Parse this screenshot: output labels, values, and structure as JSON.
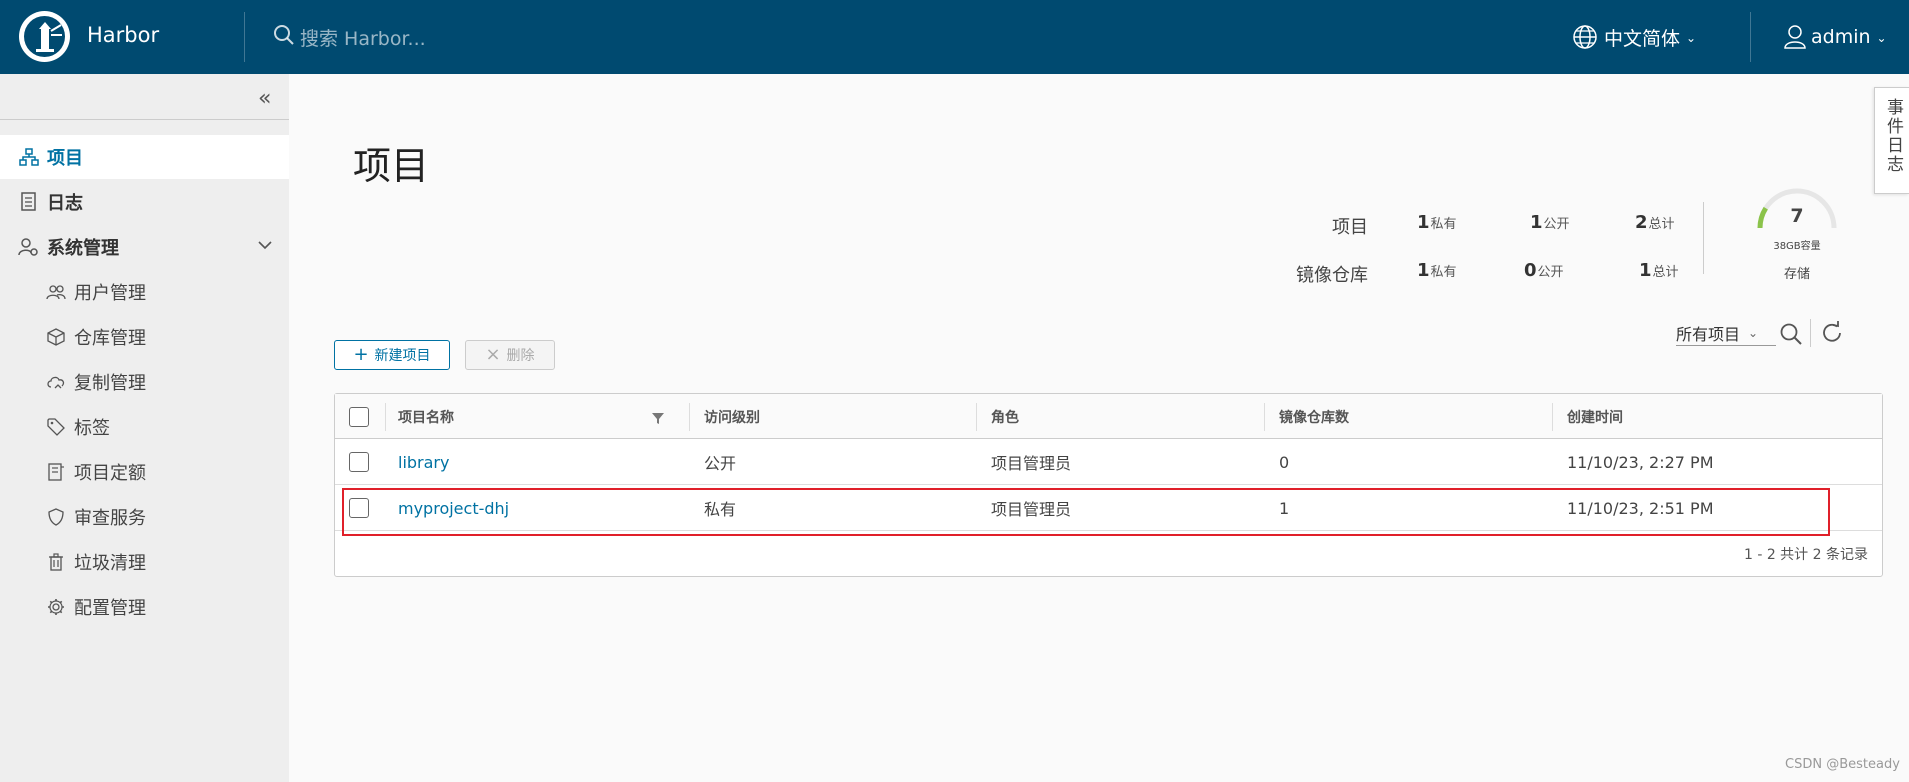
{
  "header": {
    "brand": "Harbor",
    "search_placeholder": "搜索 Harbor...",
    "language": "中文简体",
    "user": "admin"
  },
  "sidebar": {
    "items": [
      {
        "label": "项目",
        "icon": "project-icon",
        "active": true
      },
      {
        "label": "日志",
        "icon": "logs-icon"
      },
      {
        "label": "系统管理",
        "icon": "admin-icon",
        "expandable": true
      }
    ],
    "sub_items": [
      {
        "label": "用户管理",
        "icon": "users-icon"
      },
      {
        "label": "仓库管理",
        "icon": "registry-icon"
      },
      {
        "label": "复制管理",
        "icon": "replication-icon"
      },
      {
        "label": "标签",
        "icon": "tag-icon"
      },
      {
        "label": "项目定额",
        "icon": "quota-icon"
      },
      {
        "label": "审查服务",
        "icon": "shield-icon"
      },
      {
        "label": "垃圾清理",
        "icon": "trash-icon"
      },
      {
        "label": "配置管理",
        "icon": "gear-icon"
      }
    ]
  },
  "page": {
    "title": "项目",
    "event_log_tab": "事件日志"
  },
  "summary": {
    "projects": {
      "label": "项目",
      "private": "1",
      "private_label": "私有",
      "public": "1",
      "public_label": "公开",
      "total": "2",
      "total_label": "总计"
    },
    "repositories": {
      "label": "镜像仓库",
      "private": "1",
      "private_label": "私有",
      "public": "0",
      "public_label": "公开",
      "total": "1",
      "total_label": "总计"
    },
    "storage": {
      "used": "7",
      "capacity": "38GB容量",
      "label": "存储",
      "used_fraction": 0.18
    }
  },
  "toolbar": {
    "new_project": "新建项目",
    "delete": "删除",
    "filter_value": "所有项目"
  },
  "table": {
    "columns": [
      "项目名称",
      "访问级别",
      "角色",
      "镜像仓库数",
      "创建时间"
    ],
    "rows": [
      {
        "name": "library",
        "access": "公开",
        "role": "项目管理员",
        "repo_count": "0",
        "created": "11/10/23, 2:27 PM"
      },
      {
        "name": "myproject-dhj",
        "access": "私有",
        "role": "项目管理员",
        "repo_count": "1",
        "created": "11/10/23, 2:51 PM"
      }
    ],
    "footer": "1 - 2 共计 2 条记录"
  },
  "watermark": "CSDN @Besteady",
  "colors": {
    "header_bg": "#004a70",
    "accent": "#0072a3",
    "highlight": "#e0202a",
    "gauge": "#8bc34a"
  }
}
